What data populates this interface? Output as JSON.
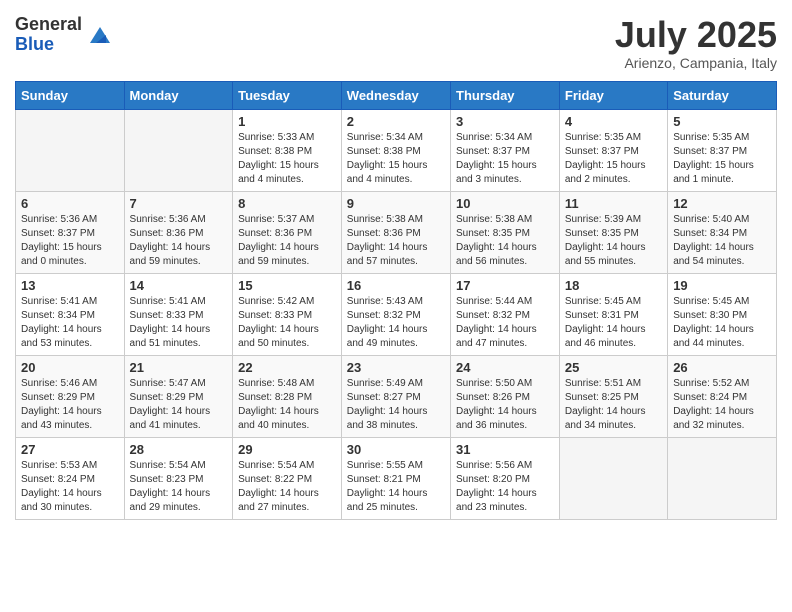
{
  "header": {
    "logo_general": "General",
    "logo_blue": "Blue",
    "month_title": "July 2025",
    "location": "Arienzo, Campania, Italy"
  },
  "weekdays": [
    "Sunday",
    "Monday",
    "Tuesday",
    "Wednesday",
    "Thursday",
    "Friday",
    "Saturday"
  ],
  "weeks": [
    [
      {
        "day": "",
        "info": ""
      },
      {
        "day": "",
        "info": ""
      },
      {
        "day": "1",
        "info": "Sunrise: 5:33 AM\nSunset: 8:38 PM\nDaylight: 15 hours\nand 4 minutes."
      },
      {
        "day": "2",
        "info": "Sunrise: 5:34 AM\nSunset: 8:38 PM\nDaylight: 15 hours\nand 4 minutes."
      },
      {
        "day": "3",
        "info": "Sunrise: 5:34 AM\nSunset: 8:37 PM\nDaylight: 15 hours\nand 3 minutes."
      },
      {
        "day": "4",
        "info": "Sunrise: 5:35 AM\nSunset: 8:37 PM\nDaylight: 15 hours\nand 2 minutes."
      },
      {
        "day": "5",
        "info": "Sunrise: 5:35 AM\nSunset: 8:37 PM\nDaylight: 15 hours\nand 1 minute."
      }
    ],
    [
      {
        "day": "6",
        "info": "Sunrise: 5:36 AM\nSunset: 8:37 PM\nDaylight: 15 hours\nand 0 minutes."
      },
      {
        "day": "7",
        "info": "Sunrise: 5:36 AM\nSunset: 8:36 PM\nDaylight: 14 hours\nand 59 minutes."
      },
      {
        "day": "8",
        "info": "Sunrise: 5:37 AM\nSunset: 8:36 PM\nDaylight: 14 hours\nand 59 minutes."
      },
      {
        "day": "9",
        "info": "Sunrise: 5:38 AM\nSunset: 8:36 PM\nDaylight: 14 hours\nand 57 minutes."
      },
      {
        "day": "10",
        "info": "Sunrise: 5:38 AM\nSunset: 8:35 PM\nDaylight: 14 hours\nand 56 minutes."
      },
      {
        "day": "11",
        "info": "Sunrise: 5:39 AM\nSunset: 8:35 PM\nDaylight: 14 hours\nand 55 minutes."
      },
      {
        "day": "12",
        "info": "Sunrise: 5:40 AM\nSunset: 8:34 PM\nDaylight: 14 hours\nand 54 minutes."
      }
    ],
    [
      {
        "day": "13",
        "info": "Sunrise: 5:41 AM\nSunset: 8:34 PM\nDaylight: 14 hours\nand 53 minutes."
      },
      {
        "day": "14",
        "info": "Sunrise: 5:41 AM\nSunset: 8:33 PM\nDaylight: 14 hours\nand 51 minutes."
      },
      {
        "day": "15",
        "info": "Sunrise: 5:42 AM\nSunset: 8:33 PM\nDaylight: 14 hours\nand 50 minutes."
      },
      {
        "day": "16",
        "info": "Sunrise: 5:43 AM\nSunset: 8:32 PM\nDaylight: 14 hours\nand 49 minutes."
      },
      {
        "day": "17",
        "info": "Sunrise: 5:44 AM\nSunset: 8:32 PM\nDaylight: 14 hours\nand 47 minutes."
      },
      {
        "day": "18",
        "info": "Sunrise: 5:45 AM\nSunset: 8:31 PM\nDaylight: 14 hours\nand 46 minutes."
      },
      {
        "day": "19",
        "info": "Sunrise: 5:45 AM\nSunset: 8:30 PM\nDaylight: 14 hours\nand 44 minutes."
      }
    ],
    [
      {
        "day": "20",
        "info": "Sunrise: 5:46 AM\nSunset: 8:29 PM\nDaylight: 14 hours\nand 43 minutes."
      },
      {
        "day": "21",
        "info": "Sunrise: 5:47 AM\nSunset: 8:29 PM\nDaylight: 14 hours\nand 41 minutes."
      },
      {
        "day": "22",
        "info": "Sunrise: 5:48 AM\nSunset: 8:28 PM\nDaylight: 14 hours\nand 40 minutes."
      },
      {
        "day": "23",
        "info": "Sunrise: 5:49 AM\nSunset: 8:27 PM\nDaylight: 14 hours\nand 38 minutes."
      },
      {
        "day": "24",
        "info": "Sunrise: 5:50 AM\nSunset: 8:26 PM\nDaylight: 14 hours\nand 36 minutes."
      },
      {
        "day": "25",
        "info": "Sunrise: 5:51 AM\nSunset: 8:25 PM\nDaylight: 14 hours\nand 34 minutes."
      },
      {
        "day": "26",
        "info": "Sunrise: 5:52 AM\nSunset: 8:24 PM\nDaylight: 14 hours\nand 32 minutes."
      }
    ],
    [
      {
        "day": "27",
        "info": "Sunrise: 5:53 AM\nSunset: 8:24 PM\nDaylight: 14 hours\nand 30 minutes."
      },
      {
        "day": "28",
        "info": "Sunrise: 5:54 AM\nSunset: 8:23 PM\nDaylight: 14 hours\nand 29 minutes."
      },
      {
        "day": "29",
        "info": "Sunrise: 5:54 AM\nSunset: 8:22 PM\nDaylight: 14 hours\nand 27 minutes."
      },
      {
        "day": "30",
        "info": "Sunrise: 5:55 AM\nSunset: 8:21 PM\nDaylight: 14 hours\nand 25 minutes."
      },
      {
        "day": "31",
        "info": "Sunrise: 5:56 AM\nSunset: 8:20 PM\nDaylight: 14 hours\nand 23 minutes."
      },
      {
        "day": "",
        "info": ""
      },
      {
        "day": "",
        "info": ""
      }
    ]
  ]
}
